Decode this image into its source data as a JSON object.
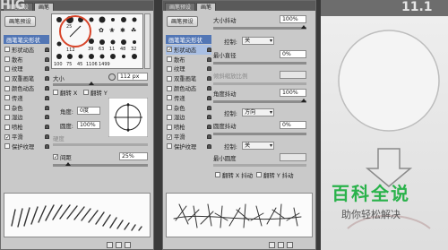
{
  "corner_left_text": "HIG",
  "corner_right_text": "11.1",
  "left_panel": {
    "tabs": [
      "画笔预设",
      "画笔"
    ],
    "preset_button": "画笔预设",
    "list": [
      {
        "label": "画笔笔尖形状",
        "header": true
      },
      {
        "label": "形状动态",
        "checked": false
      },
      {
        "label": "散布",
        "checked": false
      },
      {
        "label": "纹理",
        "checked": false
      },
      {
        "label": "双重画笔",
        "checked": false
      },
      {
        "label": "颜色动态",
        "checked": false
      },
      {
        "label": "传递",
        "checked": false
      },
      {
        "label": "杂色",
        "checked": false
      },
      {
        "label": "湿边",
        "checked": false
      },
      {
        "label": "喷枪",
        "checked": false
      },
      {
        "label": "平滑",
        "checked": true
      },
      {
        "label": "保护纹理",
        "checked": false
      }
    ],
    "swatch_numbers": [
      "",
      "25",
      "",
      "",
      "",
      "",
      "112",
      "",
      "",
      "",
      "",
      "39",
      "63",
      "11",
      "48",
      "32",
      "55",
      "100",
      "75",
      "45",
      "1106",
      "1499",
      "",
      "",
      "39",
      "54",
      "51",
      "55",
      "100",
      "75"
    ],
    "size_label": "大小",
    "size_value": "112 px",
    "flip_x": "翻转 X",
    "flip_y": "翻转 Y",
    "angle_label": "角度:",
    "angle_value": "0度",
    "roundness_label": "圆度:",
    "roundness_value": "100%",
    "hardness_label": "硬度",
    "spacing_label": "间距",
    "spacing_value": "25%",
    "spacing_checked": true
  },
  "right_panel": {
    "tabs": [
      "画笔预设",
      "画笔"
    ],
    "preset_button": "画笔预设",
    "list": [
      {
        "label": "画笔笔尖形状",
        "header": true
      },
      {
        "label": "形状动态",
        "checked": true
      },
      {
        "label": "散布",
        "checked": false
      },
      {
        "label": "纹理",
        "checked": false
      },
      {
        "label": "双重画笔",
        "checked": false
      },
      {
        "label": "颜色动态",
        "checked": false
      },
      {
        "label": "传递",
        "checked": false
      },
      {
        "label": "杂色",
        "checked": false
      },
      {
        "label": "湿边",
        "checked": false
      },
      {
        "label": "喷枪",
        "checked": false
      },
      {
        "label": "平滑",
        "checked": true
      },
      {
        "label": "保护纹理",
        "checked": false
      }
    ],
    "size_jitter_label": "大小抖动",
    "size_jitter_value": "100%",
    "control_label": "控制:",
    "control1_value": "关",
    "min_diameter_label": "最小直径",
    "min_diameter_value": "0%",
    "tilt_scale_label": "倾斜缩放比例",
    "angle_jitter_label": "角度抖动",
    "angle_jitter_value": "100%",
    "control2_value": "方向",
    "roundness_jitter_label": "圆度抖动",
    "roundness_jitter_value": "0%",
    "control3_value": "关",
    "min_roundness_label": "最小圆度",
    "flip_x_jitter": "翻转 X 抖动",
    "flip_y_jitter": "翻转 Y 抖动"
  },
  "watermark": {
    "title": "百科全说",
    "subtitle": "助你轻松解决"
  }
}
